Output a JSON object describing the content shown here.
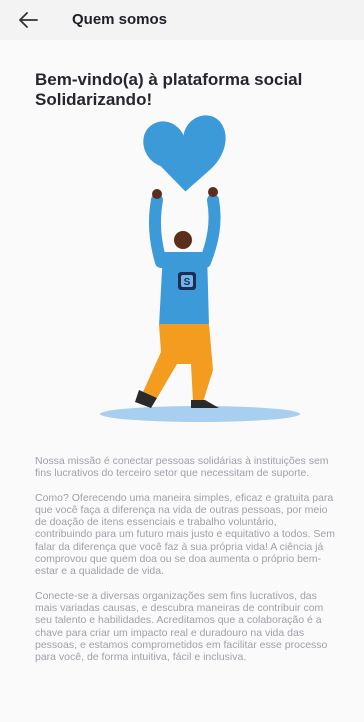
{
  "appbar": {
    "title": "Quem somos",
    "back_icon": "arrow-left-icon"
  },
  "main": {
    "welcome_title": "Bem-vindo(a) à plataforma social Solidarizando!",
    "illustration": {
      "description_icon": "person-holding-heart-illustration",
      "colors": {
        "heart": "#3d9ad8",
        "shirt": "#3d9ad8",
        "pants": "#f39c1f",
        "skin": "#5a2e1a",
        "shadow": "#a9cff0",
        "logo_badge": "#1f2c55"
      }
    },
    "paragraphs": [
      "Nossa missão é conectar pessoas solidárias à instituições sem fins lucrativos do terceiro setor que necessitam de suporte.",
      "Como? Oferecendo uma maneira simples, eficaz e gratuita para que você faça a diferença na vida de outras pessoas, por meio de doação de itens essenciais e trabalho voluntário, contribuindo para um futuro mais justo e equitativo a todos. Sem falar da diferença que você faz à sua própria vida! A ciência já comprovou que quem doa ou se doa aumenta o próprio bem-estar e a qualidade de vida.",
      "Conecte-se a diversas organizações sem fins lucrativos, das mais variadas causas, e descubra maneiras de contribuir com seu talento e habilidades. Acreditamos que a colaboração é a chave para criar um impacto real e duradouro na vida das pessoas, e estamos comprometidos em facilitar esse processo para você, de forma intuitiva, fácil e inclusiva."
    ]
  }
}
